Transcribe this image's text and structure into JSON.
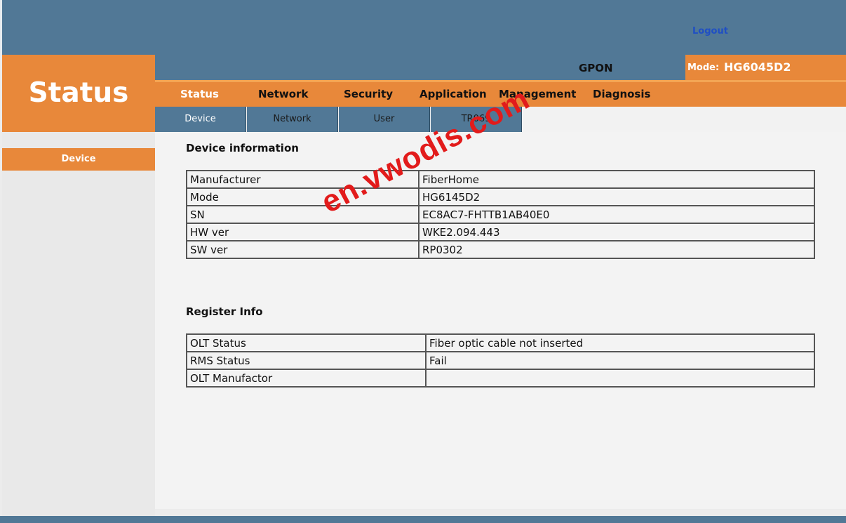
{
  "header": {
    "logout_label": "Logout",
    "section_title": "Status",
    "network_type": "GPON",
    "mode_label": "Mode:",
    "mode_value": "HG6045D2"
  },
  "main_nav": [
    {
      "label": "Status",
      "active": true
    },
    {
      "label": "Network",
      "active": false
    },
    {
      "label": "Security",
      "active": false
    },
    {
      "label": "Application",
      "active": false
    },
    {
      "label": "Management",
      "active": false
    },
    {
      "label": "Diagnosis",
      "active": false
    }
  ],
  "sub_nav": [
    {
      "label": "Device",
      "active": true
    },
    {
      "label": "Network",
      "active": false
    },
    {
      "label": "User",
      "active": false
    },
    {
      "label": "TR069",
      "active": false
    }
  ],
  "sidebar": {
    "items": [
      {
        "label": "Device",
        "active": true
      }
    ]
  },
  "device_info": {
    "title": "Device information",
    "rows": [
      {
        "label": "Manufacturer",
        "value": "FiberHome"
      },
      {
        "label": "Mode",
        "value": "HG6145D2"
      },
      {
        "label": "SN",
        "value": "EC8AC7-FHTTB1AB40E0"
      },
      {
        "label": "HW ver",
        "value": "WKE2.094.443"
      },
      {
        "label": "SW ver",
        "value": "RP0302"
      }
    ]
  },
  "register_info": {
    "title": "Register Info",
    "rows": [
      {
        "label": "OLT Status",
        "value": "Fiber optic cable not inserted"
      },
      {
        "label": "RMS Status",
        "value": "Fail"
      },
      {
        "label": "OLT Manufactor",
        "value": ""
      }
    ]
  },
  "watermark": "en.vwodis.com",
  "colors": {
    "accent_orange": "#e8883a",
    "header_blue": "#517896",
    "watermark_red": "#e21b1b"
  }
}
